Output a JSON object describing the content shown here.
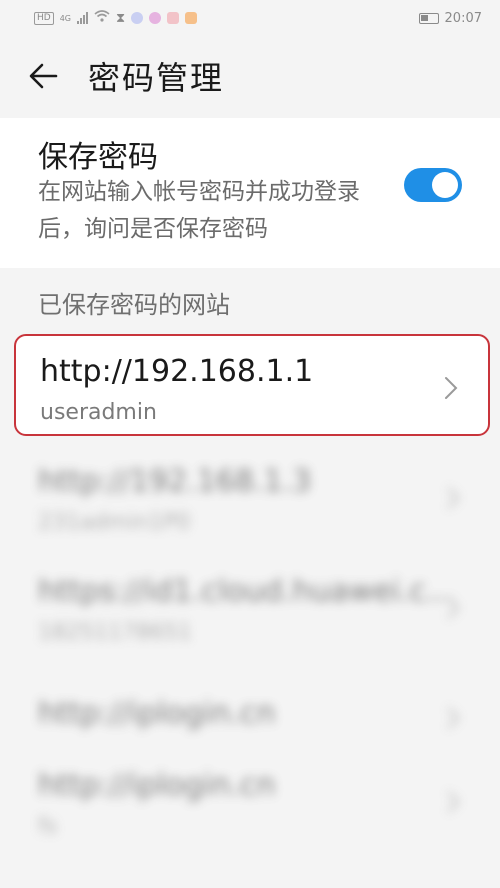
{
  "statusbar": {
    "network": "HD",
    "gen": "4G",
    "time": "20:07"
  },
  "header": {
    "title": "密码管理"
  },
  "save_password": {
    "title": "保存密码",
    "description": "在网站输入帐号密码并成功登录后，询问是否保存密码",
    "toggle_on": true,
    "accent": "#1f8fe6"
  },
  "sites_section": {
    "label": "已保存密码的网站"
  },
  "sites": [
    {
      "url": "http://192.168.1.1",
      "user": "useradmin"
    },
    {
      "url": "http://192.168.1.3",
      "user": "231admin1P0"
    },
    {
      "url": "https://id1.cloud.huawei.c...",
      "user": "18251178651"
    },
    {
      "url": "http://iplogin.cn",
      "user": ""
    },
    {
      "url": "http://iplogin.cn",
      "user": "fs"
    }
  ],
  "highlight_color": "#c8343b"
}
